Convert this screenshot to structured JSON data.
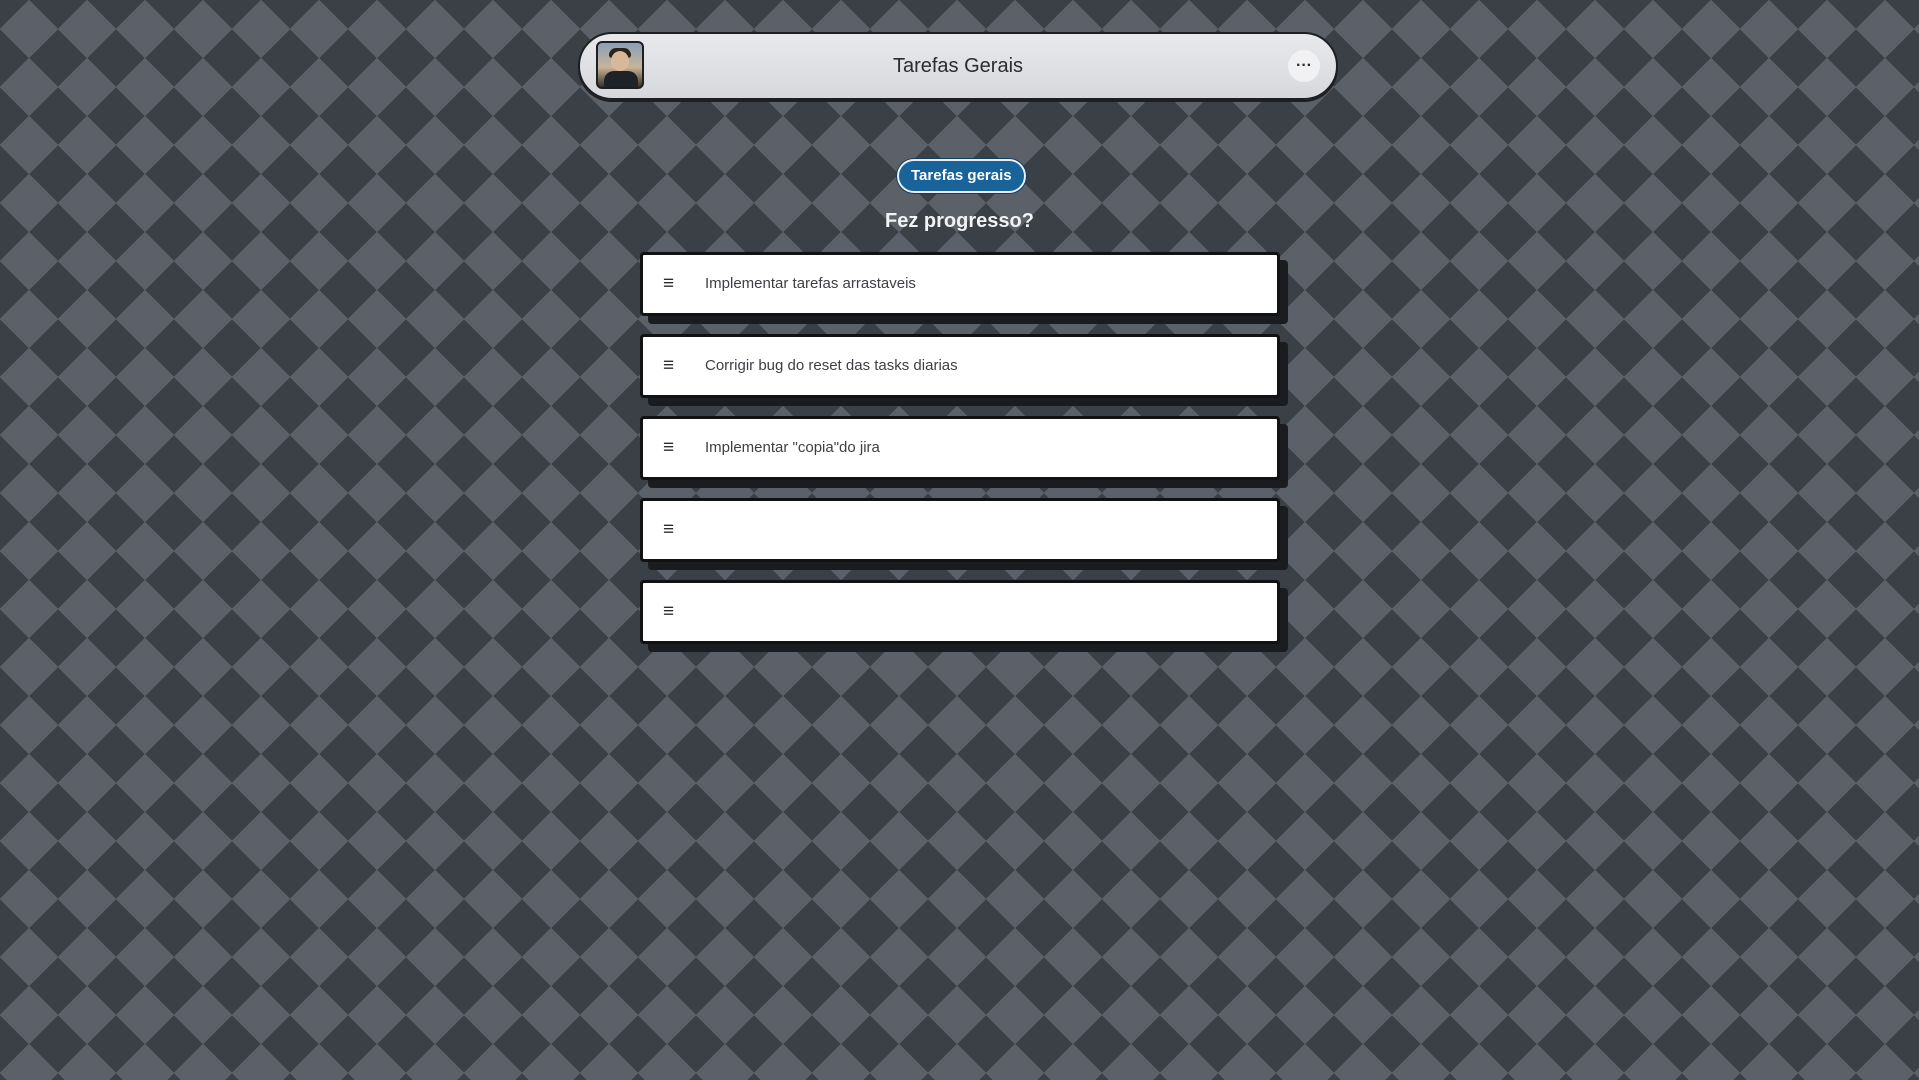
{
  "header": {
    "title": "Tarefas Gerais",
    "avatar_icon": "user-avatar",
    "more_icon": "more-horizontal-icon",
    "more_label": "···"
  },
  "category": {
    "label": "Tarefas gerais",
    "color": "#17639a"
  },
  "prompt": "Fez progresso?",
  "tasks": [
    {
      "label": "Implementar tarefas arrastaveis",
      "handle_icon": "drag-handle-icon"
    },
    {
      "label": "Corrigir bug do reset das tasks diarias",
      "handle_icon": "drag-handle-icon"
    },
    {
      "label": "Implementar \"copia\"do jira",
      "handle_icon": "drag-handle-icon"
    },
    {
      "label": "",
      "handle_icon": "drag-handle-icon"
    },
    {
      "label": "",
      "handle_icon": "drag-handle-icon"
    }
  ],
  "handle_glyph": "≡"
}
